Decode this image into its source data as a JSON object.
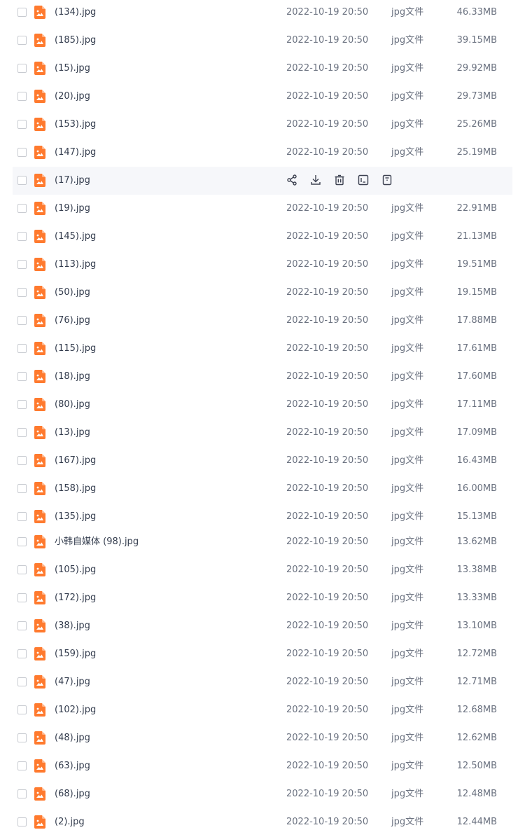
{
  "colors": {
    "file_icon": "#ff7a2e",
    "hover_row_bg": "#f6f7fa",
    "text": "#333c4d",
    "muted_text": "#6b7280",
    "action_icon": "#3c4150"
  },
  "rows": [
    {
      "name": "(134).jpg",
      "date": "2022-10-19 20:50",
      "type": "jpg文件",
      "size": "46.33MB"
    },
    {
      "name": "(185).jpg",
      "date": "2022-10-19 20:50",
      "type": "jpg文件",
      "size": "39.15MB"
    },
    {
      "name": "(15).jpg",
      "date": "2022-10-19 20:50",
      "type": "jpg文件",
      "size": "29.92MB"
    },
    {
      "name": "(20).jpg",
      "date": "2022-10-19 20:50",
      "type": "jpg文件",
      "size": "29.73MB"
    },
    {
      "name": "(153).jpg",
      "date": "2022-10-19 20:50",
      "type": "jpg文件",
      "size": "25.26MB"
    },
    {
      "name": "(147).jpg",
      "date": "2022-10-19 20:50",
      "type": "jpg文件",
      "size": "25.19MB"
    },
    {
      "name": "(17).jpg",
      "hovered": true,
      "actions": [
        "share-icon",
        "download-icon",
        "delete-icon",
        "rename-icon",
        "more-icon"
      ]
    },
    {
      "name": "(19).jpg",
      "date": "2022-10-19 20:50",
      "type": "jpg文件",
      "size": "22.91MB"
    },
    {
      "name": "(145).jpg",
      "date": "2022-10-19 20:50",
      "type": "jpg文件",
      "size": "21.13MB"
    },
    {
      "name": "(113).jpg",
      "date": "2022-10-19 20:50",
      "type": "jpg文件",
      "size": "19.51MB"
    },
    {
      "name": "(50).jpg",
      "date": "2022-10-19 20:50",
      "type": "jpg文件",
      "size": "19.15MB"
    },
    {
      "name": "(76).jpg",
      "date": "2022-10-19 20:50",
      "type": "jpg文件",
      "size": "17.88MB"
    },
    {
      "name": "(115).jpg",
      "date": "2022-10-19 20:50",
      "type": "jpg文件",
      "size": "17.61MB"
    },
    {
      "name": "(18).jpg",
      "date": "2022-10-19 20:50",
      "type": "jpg文件",
      "size": "17.60MB"
    },
    {
      "name": "(80).jpg",
      "date": "2022-10-19 20:50",
      "type": "jpg文件",
      "size": "17.11MB"
    },
    {
      "name": "(13).jpg",
      "date": "2022-10-19 20:50",
      "type": "jpg文件",
      "size": "17.09MB"
    },
    {
      "name": "(167).jpg",
      "date": "2022-10-19 20:50",
      "type": "jpg文件",
      "size": "16.43MB"
    },
    {
      "name": "(158).jpg",
      "date": "2022-10-19 20:50",
      "type": "jpg文件",
      "size": "16.00MB"
    },
    {
      "name": "(135).jpg",
      "date": "2022-10-19 20:50",
      "type": "jpg文件",
      "size": "15.13MB"
    },
    {
      "name": "小韩自媒体 (98).jpg",
      "date": "2022-10-19 20:50",
      "type": "jpg文件",
      "size": "13.62MB"
    },
    {
      "name": "(105).jpg",
      "date": "2022-10-19 20:50",
      "type": "jpg文件",
      "size": "13.38MB"
    },
    {
      "name": "(172).jpg",
      "date": "2022-10-19 20:50",
      "type": "jpg文件",
      "size": "13.33MB"
    },
    {
      "name": "(38).jpg",
      "date": "2022-10-19 20:50",
      "type": "jpg文件",
      "size": "13.10MB"
    },
    {
      "name": "(159).jpg",
      "date": "2022-10-19 20:50",
      "type": "jpg文件",
      "size": "12.72MB"
    },
    {
      "name": "(47).jpg",
      "date": "2022-10-19 20:50",
      "type": "jpg文件",
      "size": "12.71MB"
    },
    {
      "name": "(102).jpg",
      "date": "2022-10-19 20:50",
      "type": "jpg文件",
      "size": "12.68MB"
    },
    {
      "name": "(48).jpg",
      "date": "2022-10-19 20:50",
      "type": "jpg文件",
      "size": "12.62MB"
    },
    {
      "name": "(63).jpg",
      "date": "2022-10-19 20:50",
      "type": "jpg文件",
      "size": "12.50MB"
    },
    {
      "name": "(68).jpg",
      "date": "2022-10-19 20:50",
      "type": "jpg文件",
      "size": "12.48MB"
    },
    {
      "name": "(2).jpg",
      "date": "2022-10-19 20:50",
      "type": "jpg文件",
      "size": "12.44MB"
    }
  ]
}
